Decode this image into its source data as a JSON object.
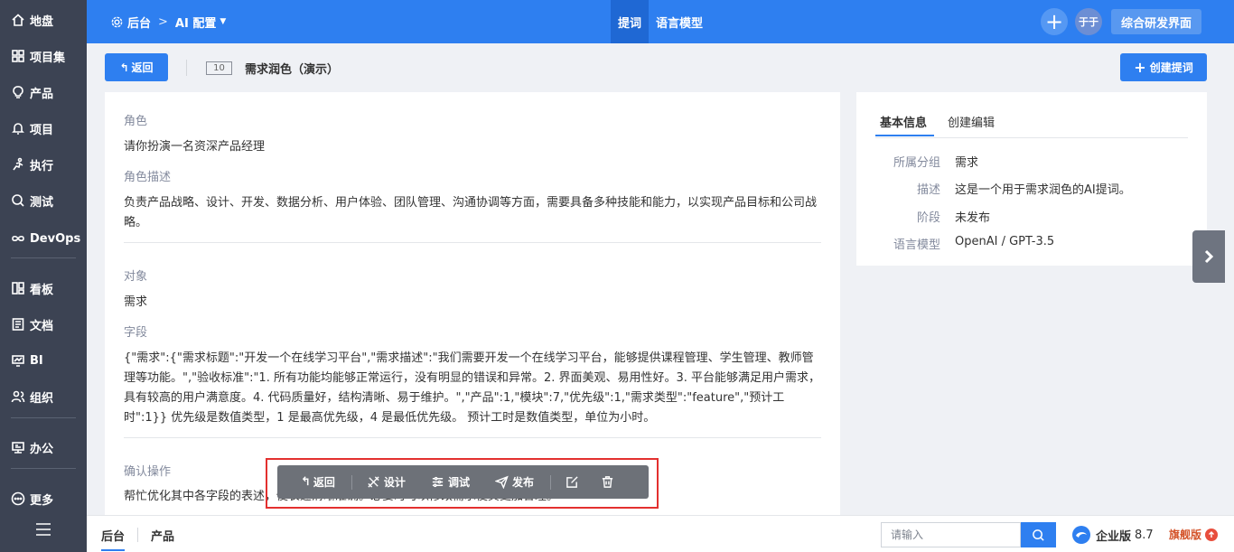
{
  "sidebar": {
    "items": [
      {
        "label": "地盘",
        "icon": "home-icon"
      },
      {
        "label": "项目集",
        "icon": "grid-icon"
      },
      {
        "label": "产品",
        "icon": "lightbulb-icon"
      },
      {
        "label": "项目",
        "icon": "bell-icon"
      },
      {
        "label": "执行",
        "icon": "runner-icon"
      },
      {
        "label": "测试",
        "icon": "magnifier-icon"
      },
      {
        "label": "DevOps",
        "icon": "infinity-icon"
      },
      {
        "label": "看板",
        "icon": "board-icon"
      },
      {
        "label": "文档",
        "icon": "doc-icon"
      },
      {
        "label": "BI",
        "icon": "monitor-icon"
      },
      {
        "label": "组织",
        "icon": "people-icon"
      },
      {
        "label": "办公",
        "icon": "desk-icon"
      },
      {
        "label": "更多",
        "icon": "more-icon"
      }
    ]
  },
  "header": {
    "breadcrumb_root": "后台",
    "breadcrumb_current": "AI 配置",
    "tabs": [
      "提词",
      "语言模型"
    ],
    "avatar_text": "于于",
    "dev_button": "综合研发界面"
  },
  "subheader": {
    "back_label": "返回",
    "id": "10",
    "title": "需求润色（演示）",
    "create_label": "创建提词"
  },
  "main": {
    "role_label": "角色",
    "role_value": "请你扮演一名资深产品经理",
    "role_desc_label": "角色描述",
    "role_desc_value": "负责产品战略、设计、开发、数据分析、用户体验、团队管理、沟通协调等方面，需要具备多种技能和能力，以实现产品目标和公司战略。",
    "object_label": "对象",
    "object_value": "需求",
    "fields_label": "字段",
    "fields_value": "{\"需求\":{\"需求标题\":\"开发一个在线学习平台\",\"需求描述\":\"我们需要开发一个在线学习平台，能够提供课程管理、学生管理、教师管理等功能。\",\"验收标准\":\"1. 所有功能均能够正常运行，没有明显的错误和异常。2. 界面美观、易用性好。3. 平台能够满足用户需求，具有较高的用户满意度。4. 代码质量好，结构清晰、易于维护。\",\"产品\":1,\"模块\":7,\"优先级\":1,\"需求类型\":\"feature\",\"预计工时\":1}} 优先级是数值类型，1 是最高优先级，4 是最低优先级。 预计工时是数值类型，单位为小时。",
    "confirm_label": "确认操作",
    "confirm_value": "帮忙优化其中各字段的表述，使表述清晰准确。必要时可以修改需求使其更加合理。"
  },
  "info_panel": {
    "tabs": [
      "基本信息",
      "创建编辑"
    ],
    "rows": [
      {
        "key": "所属分组",
        "value": "需求"
      },
      {
        "key": "描述",
        "value": "这是一个用于需求润色的AI提词。"
      },
      {
        "key": "阶段",
        "value": "未发布"
      },
      {
        "key": "语言模型",
        "value": "OpenAI / GPT-3.5"
      }
    ]
  },
  "toolbar": {
    "back": "返回",
    "design": "设计",
    "debug": "调试",
    "publish": "发布"
  },
  "bottom": {
    "tabs": [
      "后台",
      "产品"
    ],
    "search_placeholder": "请输入",
    "edition_label": "企业版",
    "edition_version": "8.7",
    "flagship_label": "旗舰版"
  },
  "colors": {
    "primary": "#2e7ff0",
    "sidebar_bg": "#3c4353",
    "highlight_frame": "#e3302f",
    "flagship": "#d4542a"
  }
}
